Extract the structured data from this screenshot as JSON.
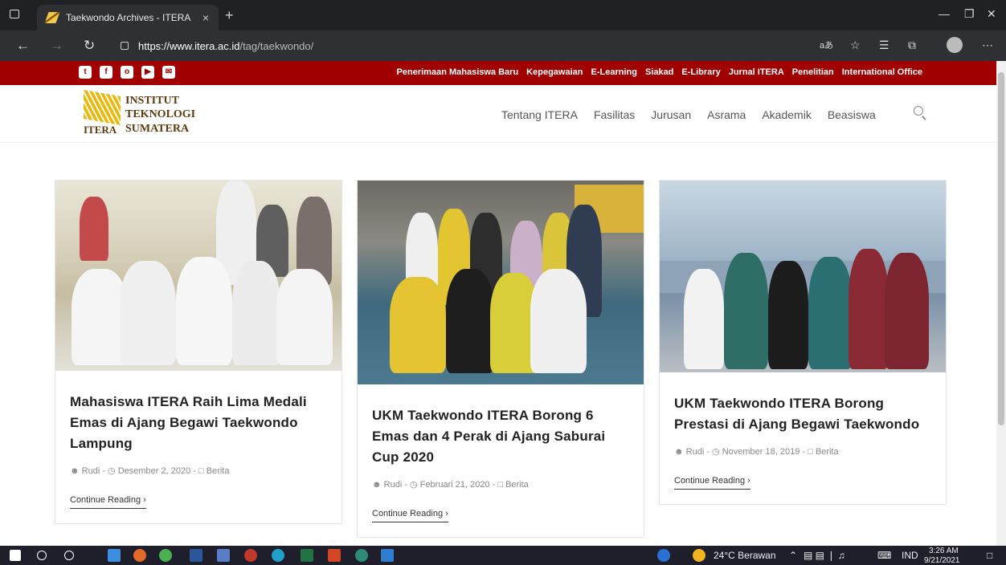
{
  "browser": {
    "tab_title": "Taekwondo Archives - ITERA",
    "tab_close": "×",
    "new_tab": "+",
    "url_host": "https://www.itera.ac.id",
    "url_path": "/tag/taekwondo/",
    "read_aloud": "aあ"
  },
  "site": {
    "top_links": [
      "Penerimaan Mahasiswa Baru",
      "Kepegawaian",
      "E-Learning",
      "Siakad",
      "E-Library",
      "Jurnal ITERA",
      "Penelitian",
      "International Office"
    ],
    "logo_line1": "INSTITUT",
    "logo_line2": "TEKNOLOGI",
    "logo_line3": "SUMATERA",
    "logo_itera": "ITERA",
    "nav": [
      "Tentang ITERA",
      "Fasilitas",
      "Jurusan",
      "Asrama",
      "Akademik",
      "Beasiswa"
    ]
  },
  "posts": [
    {
      "title": "Mahasiswa ITERA Raih Lima Medali Emas di Ajang Begawi Taekwondo Lampung",
      "author": "Rudi",
      "date": "Desember 2, 2020",
      "category": "Berita",
      "more": "Continue Reading ›"
    },
    {
      "title": "UKM Taekwondo ITERA Borong 6 Emas dan 4 Perak di Ajang Saburai Cup 2020",
      "author": "Rudi",
      "date": "Februari 21, 2020",
      "category": "Berita",
      "more": "Continue Reading ›"
    },
    {
      "title": "UKM Taekwondo ITERA Borong Prestasi di Ajang Begawi Taekwondo",
      "author": "Rudi",
      "date": "November 18, 2019",
      "category": "Berita",
      "more": "Continue Reading ›"
    }
  ],
  "taskbar": {
    "weather": "24°C Berawan",
    "lang": "IND",
    "time": "3:26 AM",
    "date": "9/21/2021"
  }
}
